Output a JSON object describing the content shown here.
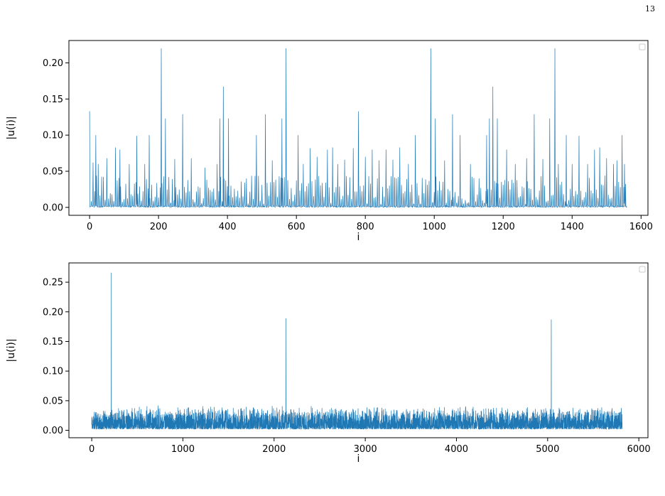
{
  "page": {
    "number": "13"
  },
  "caption": "",
  "colors": {
    "series": "#1f77b4",
    "axes": "#000000",
    "legend_border": "#cccccc"
  },
  "chart_data": [
    {
      "type": "line",
      "title": "",
      "xlabel": "i",
      "ylabel": "|u(i)|",
      "xlim": [
        -60,
        1620
      ],
      "ylim": [
        -0.011,
        0.231
      ],
      "xticks": [
        0,
        200,
        400,
        600,
        800,
        1000,
        1200,
        1400,
        1600
      ],
      "yticks": [
        0.0,
        0.05,
        0.1,
        0.15,
        0.2
      ],
      "ytick_labels": [
        "0.00",
        "0.05",
        "0.10",
        "0.15",
        "0.20"
      ],
      "legend": {
        "placement": "top-right",
        "entries": []
      },
      "n_points": 1560,
      "period": 5,
      "baseline_amplitude": 0.04,
      "series": [
        {
          "peaks": [
            {
              "x": 0,
              "y": 0.133
            },
            {
              "x": 10,
              "y": 0.062
            },
            {
              "x": 18,
              "y": 0.1
            },
            {
              "x": 25,
              "y": 0.06
            },
            {
              "x": 50,
              "y": 0.068
            },
            {
              "x": 75,
              "y": 0.083
            },
            {
              "x": 88,
              "y": 0.08
            },
            {
              "x": 115,
              "y": 0.06
            },
            {
              "x": 137,
              "y": 0.099
            },
            {
              "x": 160,
              "y": 0.06
            },
            {
              "x": 173,
              "y": 0.1
            },
            {
              "x": 208,
              "y": 0.22
            },
            {
              "x": 220,
              "y": 0.123
            },
            {
              "x": 247,
              "y": 0.067
            },
            {
              "x": 270,
              "y": 0.129
            },
            {
              "x": 295,
              "y": 0.068
            },
            {
              "x": 335,
              "y": 0.055
            },
            {
              "x": 370,
              "y": 0.06
            },
            {
              "x": 378,
              "y": 0.123
            },
            {
              "x": 388,
              "y": 0.167
            },
            {
              "x": 403,
              "y": 0.123
            },
            {
              "x": 455,
              "y": 0.04
            },
            {
              "x": 484,
              "y": 0.1
            },
            {
              "x": 510,
              "y": 0.129
            },
            {
              "x": 530,
              "y": 0.065
            },
            {
              "x": 558,
              "y": 0.123
            },
            {
              "x": 570,
              "y": 0.22
            },
            {
              "x": 605,
              "y": 0.1
            },
            {
              "x": 620,
              "y": 0.06
            },
            {
              "x": 640,
              "y": 0.082
            },
            {
              "x": 660,
              "y": 0.07
            },
            {
              "x": 690,
              "y": 0.08
            },
            {
              "x": 705,
              "y": 0.083
            },
            {
              "x": 720,
              "y": 0.06
            },
            {
              "x": 740,
              "y": 0.066
            },
            {
              "x": 765,
              "y": 0.082
            },
            {
              "x": 780,
              "y": 0.133
            },
            {
              "x": 800,
              "y": 0.07
            },
            {
              "x": 820,
              "y": 0.08
            },
            {
              "x": 840,
              "y": 0.065
            },
            {
              "x": 860,
              "y": 0.08
            },
            {
              "x": 880,
              "y": 0.066
            },
            {
              "x": 900,
              "y": 0.083
            },
            {
              "x": 925,
              "y": 0.06
            },
            {
              "x": 945,
              "y": 0.1
            },
            {
              "x": 990,
              "y": 0.22
            },
            {
              "x": 1003,
              "y": 0.123
            },
            {
              "x": 1030,
              "y": 0.065
            },
            {
              "x": 1053,
              "y": 0.129
            },
            {
              "x": 1075,
              "y": 0.1
            },
            {
              "x": 1105,
              "y": 0.06
            },
            {
              "x": 1130,
              "y": 0.04
            },
            {
              "x": 1152,
              "y": 0.1
            },
            {
              "x": 1160,
              "y": 0.123
            },
            {
              "x": 1170,
              "y": 0.167
            },
            {
              "x": 1183,
              "y": 0.123
            },
            {
              "x": 1210,
              "y": 0.08
            },
            {
              "x": 1235,
              "y": 0.06
            },
            {
              "x": 1268,
              "y": 0.068
            },
            {
              "x": 1290,
              "y": 0.129
            },
            {
              "x": 1315,
              "y": 0.067
            },
            {
              "x": 1335,
              "y": 0.123
            },
            {
              "x": 1350,
              "y": 0.22
            },
            {
              "x": 1360,
              "y": 0.06
            },
            {
              "x": 1383,
              "y": 0.1
            },
            {
              "x": 1400,
              "y": 0.06
            },
            {
              "x": 1420,
              "y": 0.099
            },
            {
              "x": 1445,
              "y": 0.06
            },
            {
              "x": 1465,
              "y": 0.08
            },
            {
              "x": 1480,
              "y": 0.083
            },
            {
              "x": 1500,
              "y": 0.068
            },
            {
              "x": 1520,
              "y": 0.06
            },
            {
              "x": 1530,
              "y": 0.065
            },
            {
              "x": 1545,
              "y": 0.1
            },
            {
              "x": 1552,
              "y": 0.06
            }
          ]
        }
      ]
    },
    {
      "type": "line",
      "title": "",
      "xlabel": "i",
      "ylabel": "|u(i)|",
      "xlim": [
        -250,
        6100
      ],
      "ylim": [
        -0.0125,
        0.2825
      ],
      "xticks": [
        0,
        1000,
        2000,
        3000,
        4000,
        5000,
        6000
      ],
      "yticks": [
        0.0,
        0.05,
        0.1,
        0.15,
        0.2,
        0.25
      ],
      "ytick_labels": [
        "0.00",
        "0.05",
        "0.10",
        "0.15",
        "0.20",
        "0.25"
      ],
      "legend": {
        "placement": "top-right",
        "entries": []
      },
      "n_points": 5820,
      "noise_max": 0.04,
      "series": [
        {
          "peaks": [
            {
              "x": 215,
              "y": 0.266
            },
            {
              "x": 2130,
              "y": 0.189
            },
            {
              "x": 5040,
              "y": 0.187
            }
          ]
        }
      ]
    }
  ]
}
